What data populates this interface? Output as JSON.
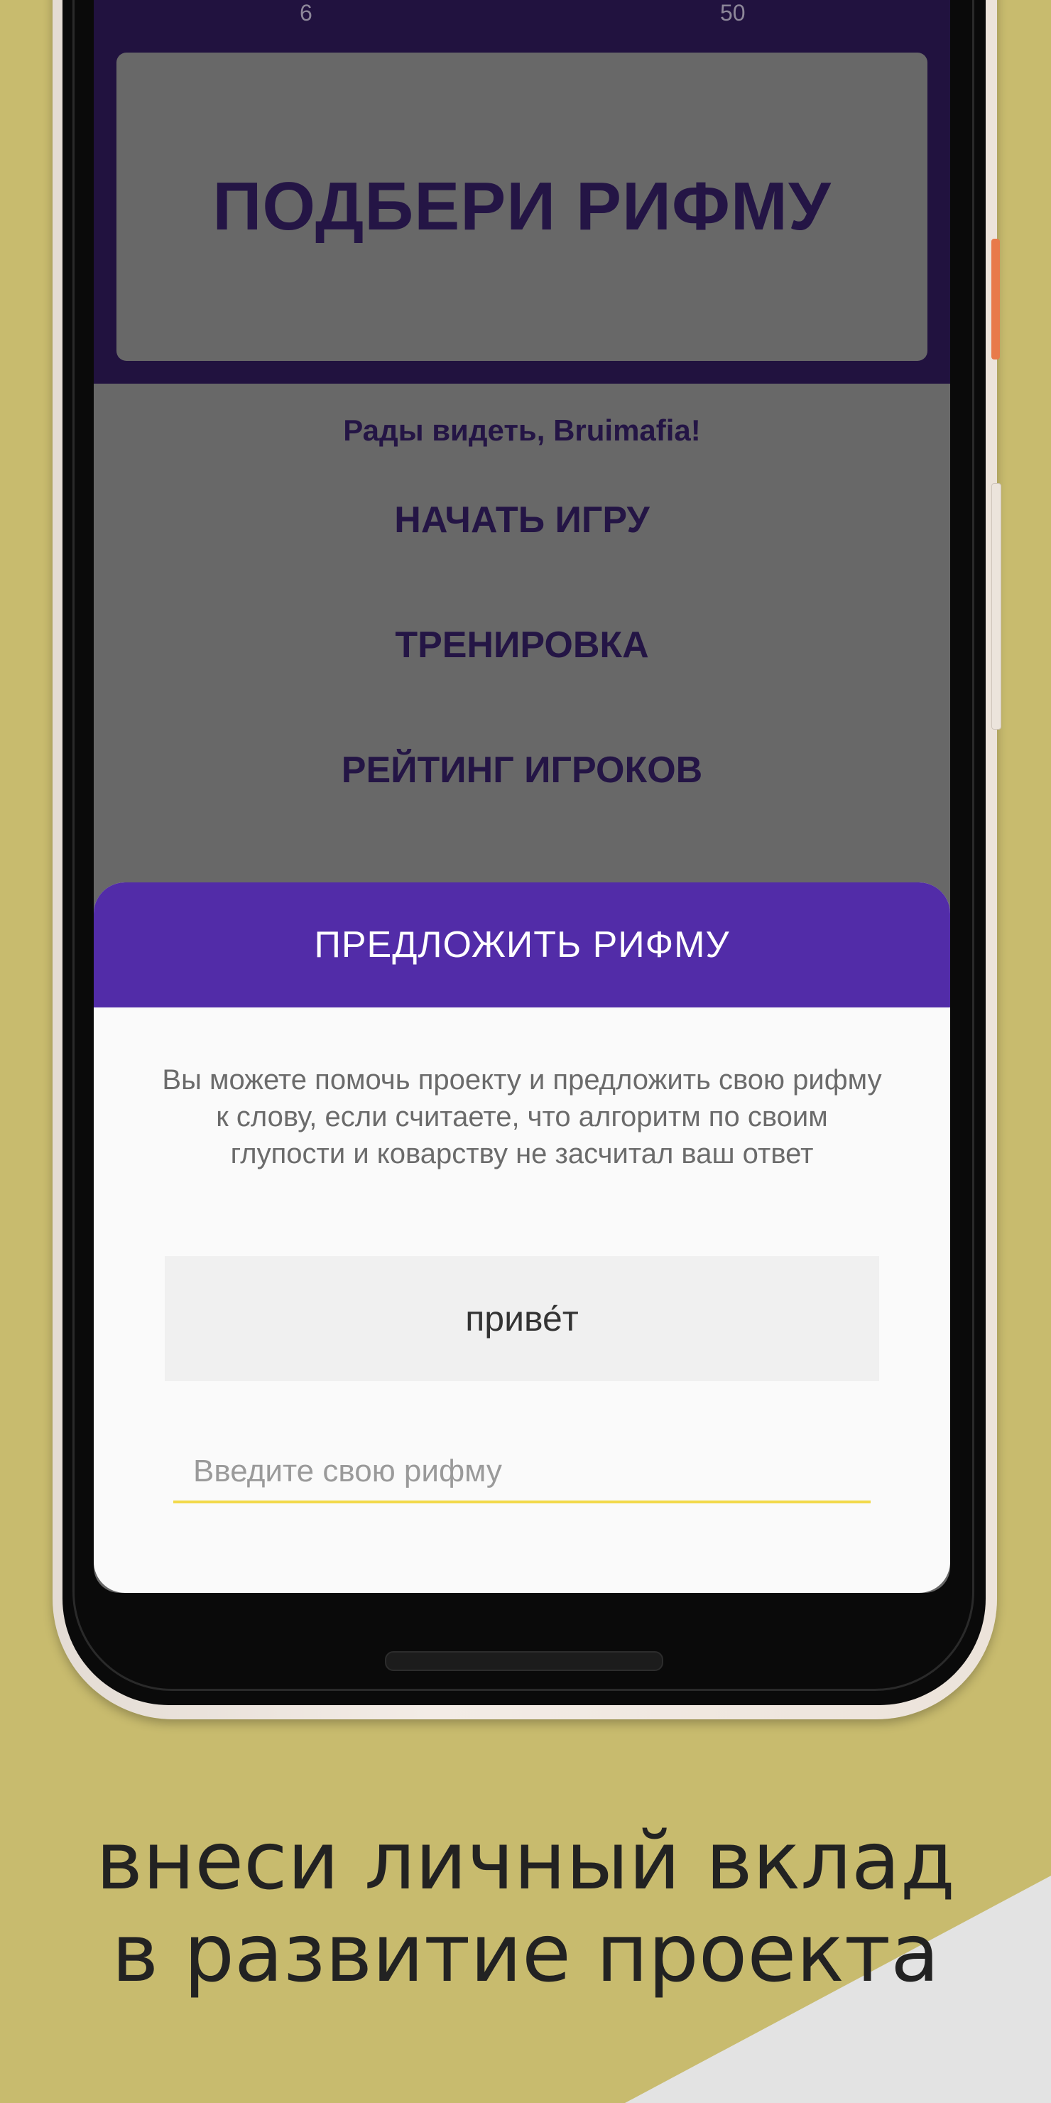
{
  "header": {
    "stat_left": "6",
    "stat_right": "50",
    "app_title": "ПОДБЕРИ РИФМУ"
  },
  "main": {
    "greeting": "Рады видеть, Bruimafia!",
    "menu": {
      "start": "НАЧАТЬ ИГРУ",
      "training": "ТРЕНИРОВКА",
      "rating": "РЕЙТИНГ ИГРОКОВ"
    }
  },
  "dialog": {
    "title": "ПРЕДЛОЖИТЬ РИФМУ",
    "description": "Вы можете помочь проекту и предложить свою рифму к слову, если считаете, что алгоритм по своим глупости и коварству не засчитал ваш ответ",
    "word": "приве́т",
    "input_placeholder": "Введите свою рифму",
    "input_value": ""
  },
  "promo": {
    "line1": "внеси личный вклад",
    "line2": "в развитие проекта"
  },
  "colors": {
    "background": "#c8bb6e",
    "header_bg": "#21123f",
    "dialog_header": "#522ca8",
    "menu_text": "#241545",
    "input_underline": "#f2d94a"
  }
}
